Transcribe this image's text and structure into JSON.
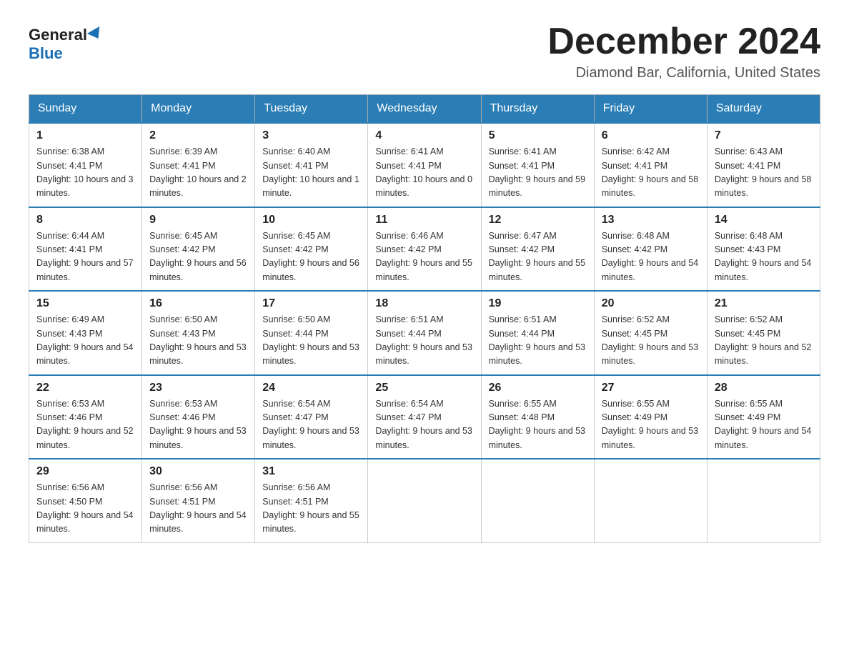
{
  "header": {
    "logo_general": "General",
    "logo_blue": "Blue",
    "title": "December 2024",
    "subtitle": "Diamond Bar, California, United States"
  },
  "columns": [
    "Sunday",
    "Monday",
    "Tuesday",
    "Wednesday",
    "Thursday",
    "Friday",
    "Saturday"
  ],
  "weeks": [
    [
      {
        "day": "1",
        "sunrise": "Sunrise: 6:38 AM",
        "sunset": "Sunset: 4:41 PM",
        "daylight": "Daylight: 10 hours and 3 minutes."
      },
      {
        "day": "2",
        "sunrise": "Sunrise: 6:39 AM",
        "sunset": "Sunset: 4:41 PM",
        "daylight": "Daylight: 10 hours and 2 minutes."
      },
      {
        "day": "3",
        "sunrise": "Sunrise: 6:40 AM",
        "sunset": "Sunset: 4:41 PM",
        "daylight": "Daylight: 10 hours and 1 minute."
      },
      {
        "day": "4",
        "sunrise": "Sunrise: 6:41 AM",
        "sunset": "Sunset: 4:41 PM",
        "daylight": "Daylight: 10 hours and 0 minutes."
      },
      {
        "day": "5",
        "sunrise": "Sunrise: 6:41 AM",
        "sunset": "Sunset: 4:41 PM",
        "daylight": "Daylight: 9 hours and 59 minutes."
      },
      {
        "day": "6",
        "sunrise": "Sunrise: 6:42 AM",
        "sunset": "Sunset: 4:41 PM",
        "daylight": "Daylight: 9 hours and 58 minutes."
      },
      {
        "day": "7",
        "sunrise": "Sunrise: 6:43 AM",
        "sunset": "Sunset: 4:41 PM",
        "daylight": "Daylight: 9 hours and 58 minutes."
      }
    ],
    [
      {
        "day": "8",
        "sunrise": "Sunrise: 6:44 AM",
        "sunset": "Sunset: 4:41 PM",
        "daylight": "Daylight: 9 hours and 57 minutes."
      },
      {
        "day": "9",
        "sunrise": "Sunrise: 6:45 AM",
        "sunset": "Sunset: 4:42 PM",
        "daylight": "Daylight: 9 hours and 56 minutes."
      },
      {
        "day": "10",
        "sunrise": "Sunrise: 6:45 AM",
        "sunset": "Sunset: 4:42 PM",
        "daylight": "Daylight: 9 hours and 56 minutes."
      },
      {
        "day": "11",
        "sunrise": "Sunrise: 6:46 AM",
        "sunset": "Sunset: 4:42 PM",
        "daylight": "Daylight: 9 hours and 55 minutes."
      },
      {
        "day": "12",
        "sunrise": "Sunrise: 6:47 AM",
        "sunset": "Sunset: 4:42 PM",
        "daylight": "Daylight: 9 hours and 55 minutes."
      },
      {
        "day": "13",
        "sunrise": "Sunrise: 6:48 AM",
        "sunset": "Sunset: 4:42 PM",
        "daylight": "Daylight: 9 hours and 54 minutes."
      },
      {
        "day": "14",
        "sunrise": "Sunrise: 6:48 AM",
        "sunset": "Sunset: 4:43 PM",
        "daylight": "Daylight: 9 hours and 54 minutes."
      }
    ],
    [
      {
        "day": "15",
        "sunrise": "Sunrise: 6:49 AM",
        "sunset": "Sunset: 4:43 PM",
        "daylight": "Daylight: 9 hours and 54 minutes."
      },
      {
        "day": "16",
        "sunrise": "Sunrise: 6:50 AM",
        "sunset": "Sunset: 4:43 PM",
        "daylight": "Daylight: 9 hours and 53 minutes."
      },
      {
        "day": "17",
        "sunrise": "Sunrise: 6:50 AM",
        "sunset": "Sunset: 4:44 PM",
        "daylight": "Daylight: 9 hours and 53 minutes."
      },
      {
        "day": "18",
        "sunrise": "Sunrise: 6:51 AM",
        "sunset": "Sunset: 4:44 PM",
        "daylight": "Daylight: 9 hours and 53 minutes."
      },
      {
        "day": "19",
        "sunrise": "Sunrise: 6:51 AM",
        "sunset": "Sunset: 4:44 PM",
        "daylight": "Daylight: 9 hours and 53 minutes."
      },
      {
        "day": "20",
        "sunrise": "Sunrise: 6:52 AM",
        "sunset": "Sunset: 4:45 PM",
        "daylight": "Daylight: 9 hours and 53 minutes."
      },
      {
        "day": "21",
        "sunrise": "Sunrise: 6:52 AM",
        "sunset": "Sunset: 4:45 PM",
        "daylight": "Daylight: 9 hours and 52 minutes."
      }
    ],
    [
      {
        "day": "22",
        "sunrise": "Sunrise: 6:53 AM",
        "sunset": "Sunset: 4:46 PM",
        "daylight": "Daylight: 9 hours and 52 minutes."
      },
      {
        "day": "23",
        "sunrise": "Sunrise: 6:53 AM",
        "sunset": "Sunset: 4:46 PM",
        "daylight": "Daylight: 9 hours and 53 minutes."
      },
      {
        "day": "24",
        "sunrise": "Sunrise: 6:54 AM",
        "sunset": "Sunset: 4:47 PM",
        "daylight": "Daylight: 9 hours and 53 minutes."
      },
      {
        "day": "25",
        "sunrise": "Sunrise: 6:54 AM",
        "sunset": "Sunset: 4:47 PM",
        "daylight": "Daylight: 9 hours and 53 minutes."
      },
      {
        "day": "26",
        "sunrise": "Sunrise: 6:55 AM",
        "sunset": "Sunset: 4:48 PM",
        "daylight": "Daylight: 9 hours and 53 minutes."
      },
      {
        "day": "27",
        "sunrise": "Sunrise: 6:55 AM",
        "sunset": "Sunset: 4:49 PM",
        "daylight": "Daylight: 9 hours and 53 minutes."
      },
      {
        "day": "28",
        "sunrise": "Sunrise: 6:55 AM",
        "sunset": "Sunset: 4:49 PM",
        "daylight": "Daylight: 9 hours and 54 minutes."
      }
    ],
    [
      {
        "day": "29",
        "sunrise": "Sunrise: 6:56 AM",
        "sunset": "Sunset: 4:50 PM",
        "daylight": "Daylight: 9 hours and 54 minutes."
      },
      {
        "day": "30",
        "sunrise": "Sunrise: 6:56 AM",
        "sunset": "Sunset: 4:51 PM",
        "daylight": "Daylight: 9 hours and 54 minutes."
      },
      {
        "day": "31",
        "sunrise": "Sunrise: 6:56 AM",
        "sunset": "Sunset: 4:51 PM",
        "daylight": "Daylight: 9 hours and 55 minutes."
      },
      null,
      null,
      null,
      null
    ]
  ]
}
